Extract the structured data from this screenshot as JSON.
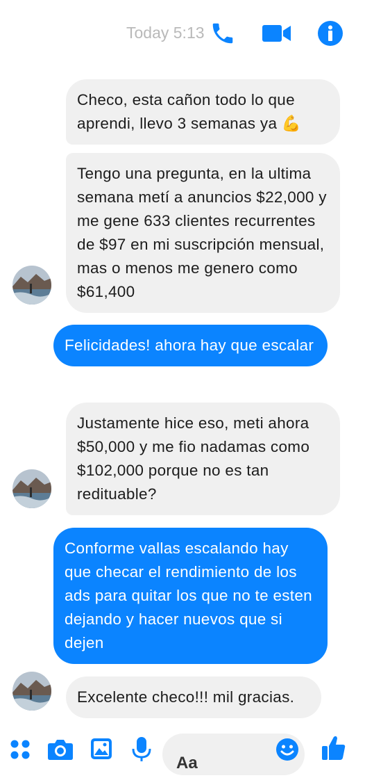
{
  "header": {
    "timestamp": "Today 5:13",
    "accent_color": "#0b84ff",
    "icons": [
      "phone-icon",
      "video-camera-icon",
      "info-icon"
    ]
  },
  "messages": [
    {
      "side": "incoming",
      "text": "Checo, esta cañon todo lo que aprendi, llevo 3 semanas ya 💪"
    },
    {
      "side": "incoming",
      "text": "Tengo una pregunta, en la ultima semana metí a anuncios $22,000 y me gene 633 clientes recurrentes de $97 en mi suscripción mensual, mas o menos me genero como $61,400"
    },
    {
      "side": "outgoing",
      "text": "Felicidades! ahora hay que escalar"
    },
    {
      "side": "incoming",
      "text": "Justamente hice eso, meti ahora $50,000 y me fio nadamas como $102,000 porque no es tan redituable?"
    },
    {
      "side": "outgoing",
      "text": "Conforme vallas escalando hay que checar el rendimiento de los ads para quitar los que no te esten dejando y hacer nuevos que si dejen"
    },
    {
      "side": "incoming",
      "text": "Excelente checo!!! mil gracias."
    }
  ],
  "composer": {
    "placeholder": "Aa",
    "icons": [
      "apps-icon",
      "camera-icon",
      "gallery-icon",
      "microphone-icon",
      "emoji-icon",
      "thumbs-up-icon"
    ]
  }
}
